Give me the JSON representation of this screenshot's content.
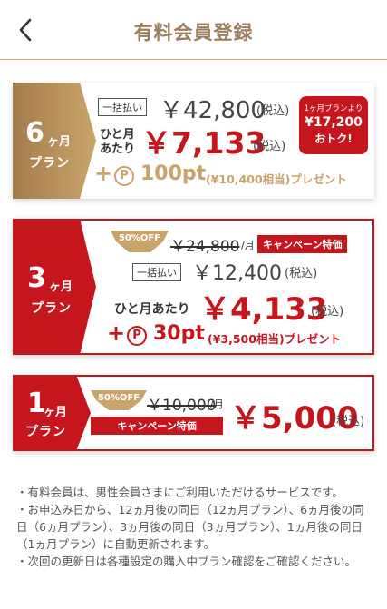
{
  "header": {
    "title": "有料会員登録",
    "back_icon": "chevron-left-icon"
  },
  "colors": {
    "gold": "#b8925f",
    "red": "#c5161d",
    "brown_title": "#9c7d5e"
  },
  "plans": {
    "six": {
      "num": "6",
      "unit": "ヶ月",
      "plan_label": "プラン",
      "lump_label": "一括払い",
      "price": "￥42,800",
      "tax": "(税込)",
      "per_month_label_1": "ひと月",
      "per_month_label_2": "あたり",
      "per_month": "￥7,133",
      "badge_line1": "1ヶ月プランより",
      "badge_line2": "¥17,200",
      "badge_line3": "おトク!",
      "plus": "+",
      "coin": "P",
      "points": "100pt",
      "points_note": "(¥10,400相当)プレゼント"
    },
    "three": {
      "num": "3",
      "unit": "ヶ月",
      "plan_label": "プラン",
      "off": "50%OFF",
      "old_price": "￥24,800",
      "old_unit": "/月",
      "campaign": "キャンペーン特価",
      "lump_label": "一括払い",
      "price": "￥12,400",
      "tax": "(税込)",
      "per_month_label": "ひと月あたり",
      "per_month": "￥4,133",
      "plus": "+",
      "coin": "P",
      "points": "30pt",
      "points_note": "(¥3,500相当)プレゼント"
    },
    "one": {
      "num": "1",
      "unit": "ヶ月",
      "plan_label": "プラン",
      "off": "50%OFF",
      "old_price": "￥10,000",
      "old_unit": "/月",
      "campaign": "キャンペーン特価",
      "price": "￥5,000",
      "tax": "(税込)"
    }
  },
  "notes": [
    "・有料会員は、男性会員さまにご利用いただけるサービスです。",
    "・お申込み日から、12ヵ月後の同日（12ヵ月プラン）、6ヵ月後の同日（6ヵ月プラン）、3ヵ月後の同日（3ヵ月プラン）、1ヵ月後の同日（1ヵ月プラン）に自動更新されます。",
    "・次回の更新日は各種設定の購入中プラン確認をご確認ください。"
  ]
}
